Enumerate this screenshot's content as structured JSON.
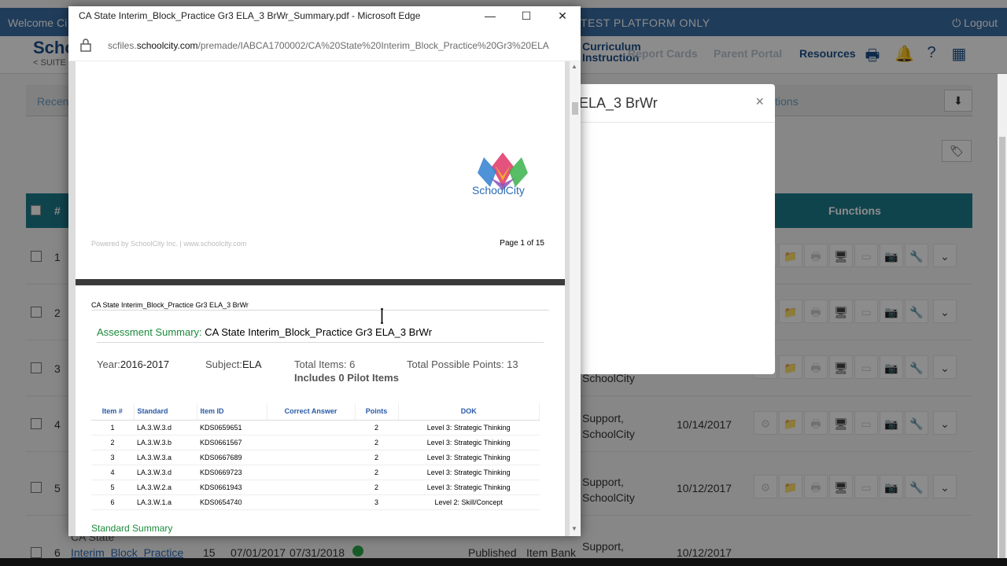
{
  "app": {
    "welcome": "Welcome Ci",
    "platform_notice": "TEST PLATFORM ONLY",
    "logout": "Logout",
    "logo_text": "Schoo",
    "logo_sub": "< SUITE",
    "nav_curriculum": "Curriculum",
    "nav_instruction": "Instruction",
    "nav_report_cards": "Report Cards",
    "nav_parent_portal": "Parent Portal",
    "nav_resources": "Resources",
    "subtab_recent": "Recen",
    "subtab_questions": "tions",
    "functions_header": "Functions",
    "num_header": "#",
    "rows": [
      {
        "num": "1",
        "author1": "",
        "author2": "",
        "date": ""
      },
      {
        "num": "2",
        "author1": "",
        "author2": "",
        "date": ""
      },
      {
        "num": "3",
        "author1": "",
        "author2": "SchoolCity",
        "date": ""
      },
      {
        "num": "4",
        "author1": "Support,",
        "author2": "SchoolCity",
        "date": "10/14/2017"
      },
      {
        "num": "5",
        "author1": "Support,",
        "author2": "SchoolCity",
        "date": "10/12/2017"
      },
      {
        "num": "6",
        "author1": "Support,",
        "author2": "",
        "date": "10/12/2017"
      }
    ],
    "row6": {
      "name1": "CA State",
      "name2": "Interim_Block_Practice",
      "items": "15",
      "start": "07/01/2017",
      "end": "07/31/2018",
      "status": "Published",
      "source": "Item Bank"
    }
  },
  "modal": {
    "title": "ELA_3 BrWr",
    "close": "×"
  },
  "edge": {
    "title": "CA State Interim_Block_Practice Gr3 ELA_3 BrWr_Summary.pdf - Microsoft Edge",
    "minimize": "—",
    "maximize": "☐",
    "close": "✕",
    "url_pre": "scfiles.",
    "url_domain": "schoolcity.com",
    "url_post": "/premade/IABCA1700002/CA%20State%20Interim_Block_Practice%20Gr3%20ELA"
  },
  "pdf": {
    "page1": {
      "logo_text": "SchoolCity",
      "footer_left": "Powered by SchoolCity Inc. | www.schoolcity.com",
      "footer_right": "Page 1 of 15"
    },
    "page2": {
      "header": "CA State Interim_Block_Practice Gr3 ELA_3 BrWr",
      "summary_label": "Assessment Summary:",
      "summary_title": "CA State Interim_Block_Practice Gr3 ELA_3 BrWr",
      "year_label": "Year:",
      "year_value": "2016-2017",
      "subject_label": "Subject:",
      "subject_value": "ELA",
      "total_items": "Total Items: 6",
      "total_points": "Total Possible Points: 13",
      "pilot": "Includes 0 Pilot Items",
      "columns": [
        "Item #",
        "Standard",
        "Item ID",
        "Correct Answer",
        "Points",
        "DOK"
      ],
      "items": [
        {
          "n": "1",
          "std": "LA.3.W.3.d",
          "id": "KDS0659651",
          "ans": "",
          "pts": "2",
          "dok": "Level 3: Strategic Thinking"
        },
        {
          "n": "2",
          "std": "LA.3.W.3.b",
          "id": "KDS0661567",
          "ans": "",
          "pts": "2",
          "dok": "Level 3: Strategic Thinking"
        },
        {
          "n": "3",
          "std": "LA.3.W.3.a",
          "id": "KDS0667689",
          "ans": "",
          "pts": "2",
          "dok": "Level 3: Strategic Thinking"
        },
        {
          "n": "4",
          "std": "LA.3.W.3.d",
          "id": "KDS0669723",
          "ans": "",
          "pts": "2",
          "dok": "Level 3: Strategic Thinking"
        },
        {
          "n": "5",
          "std": "LA.3.W.2.a",
          "id": "KDS0661943",
          "ans": "",
          "pts": "2",
          "dok": "Level 3: Strategic Thinking"
        },
        {
          "n": "6",
          "std": "LA.3.W.1.a",
          "id": "KDS0654740",
          "ans": "",
          "pts": "3",
          "dok": "Level 2: Skill/Concept"
        }
      ],
      "standard_summary": "Standard Summary"
    }
  },
  "colors": {
    "teal_header": "#1e7d8c",
    "topbar": "#3a6ea5",
    "summary_green": "#1a8a3a",
    "table_blue": "#2a5aa8"
  }
}
